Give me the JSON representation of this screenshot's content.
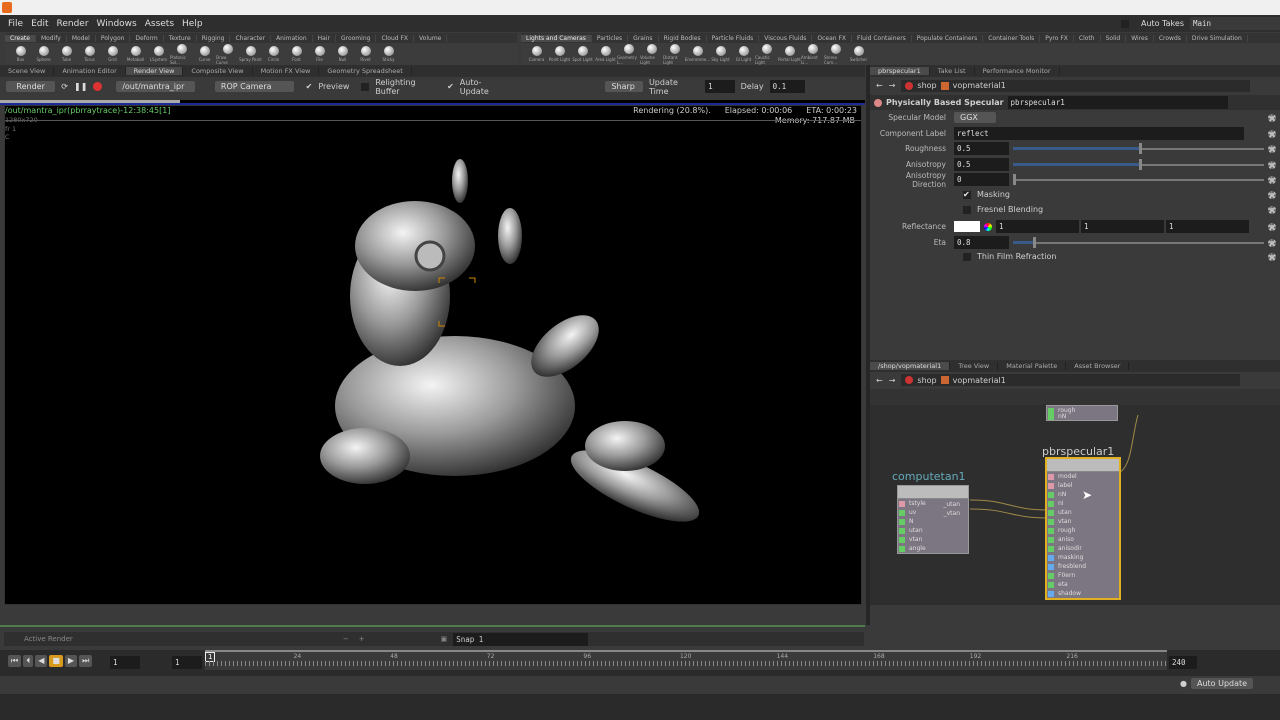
{
  "menu": [
    "File",
    "Edit",
    "Render",
    "Windows",
    "Assets",
    "Help"
  ],
  "auto_takes": "Auto Takes",
  "takes_value": "Main",
  "shelf_left_tabs": [
    "Create",
    "Modify",
    "Model",
    "Polygon",
    "Deform",
    "Texture",
    "Rigging",
    "Character",
    "Animation",
    "Hair",
    "Grooming",
    "Cloud FX",
    "Volume"
  ],
  "shelf_left_tools": [
    "Box",
    "Sphere",
    "Tube",
    "Torus",
    "Grid",
    "Metaball",
    "LSystem",
    "Platonic Sol...",
    "Curve",
    "Draw Curve",
    "Spray Paint",
    "Circle",
    "Font",
    "File",
    "Null",
    "Rivet",
    "Sticky"
  ],
  "shelf_right_tabs": [
    "Lights and Cameras",
    "Particles",
    "Grains",
    "Rigid Bodies",
    "Particle Fluids",
    "Viscous Fluids",
    "Ocean FX",
    "Fluid Containers",
    "Populate Containers",
    "Container Tools",
    "Pyro FX",
    "Cloth",
    "Solid",
    "Wires",
    "Crowds",
    "Drive Simulation"
  ],
  "shelf_right_tools": [
    "Camera",
    "Point Light",
    "Spot Light",
    "Area Light",
    "Geometry L...",
    "Volume Light",
    "Distant Light",
    "Environme...",
    "Sky Light",
    "GI Light",
    "Caustic Light",
    "Portal Light",
    "Ambient Li...",
    "Stereo Cam...",
    "Switcher"
  ],
  "left_pane_tabs": [
    "Scene View",
    "Animation Editor",
    "Render View",
    "Composite View",
    "Motion FX View",
    "Geometry Spreadsheet"
  ],
  "render_toolbar": {
    "render": "Render",
    "rop": "/out/mantra_ipr",
    "camera": "ROP Camera",
    "preview": "Preview",
    "relighting": "Relighting Buffer",
    "auto_update": "Auto-Update",
    "sharp": "Sharp",
    "update_time_label": "Update Time",
    "update_time": "1",
    "delay_label": "Delay",
    "delay": "0.1"
  },
  "render_view": {
    "progress": 0.208,
    "path": "/out/mantra_ipr(pbrraytrace)-12:38:45[1]",
    "resolution": "1280x720",
    "fr": "fr 1",
    "c": "C",
    "status": "Rendering (20.8%).",
    "elapsed": "Elapsed: 0:00:06",
    "eta": "ETA: 0:00:23",
    "memory": "Memory:   717.87 MB"
  },
  "active_render": {
    "label": "Active Render",
    "snap": "Snap 1"
  },
  "timeline": {
    "frame": "1",
    "start": "1",
    "end": "240",
    "current": "1",
    "ticks": [
      "24",
      "48",
      "72",
      "96",
      "120",
      "144",
      "168",
      "192",
      "216"
    ],
    "auto_update": "Auto Update"
  },
  "params_tabs": [
    "pbrspecular1",
    "Take List",
    "Performance Monitor"
  ],
  "path": {
    "shop": "shop",
    "material": "vopmaterial1"
  },
  "params": {
    "type": "Physically Based Specular",
    "name": "pbrspecular1",
    "specular_model_label": "Specular Model",
    "specular_model": "GGX",
    "component_label_label": "Component Label",
    "component_label": "reflect",
    "roughness_label": "Roughness",
    "roughness": "0.5",
    "anisotropy_label": "Anisotropy",
    "anisotropy": "0.5",
    "aniso_dir_label": "Anisotropy Direction",
    "aniso_dir": "0",
    "masking": "Masking",
    "fresnel": "Fresnel Blending",
    "reflectance_label": "Reflectance",
    "reflectance": [
      "1",
      "1",
      "1"
    ],
    "eta_label": "Eta",
    "eta": "0.8",
    "thin_film": "Thin Film Refraction"
  },
  "network_tabs": [
    "/shop/vopmaterial1",
    "Tree View",
    "Material Palette",
    "Asset Browser"
  ],
  "network": {
    "top_ports": [
      "rough",
      "nN"
    ],
    "computetan": {
      "name": "computetan1",
      "inputs": [
        "tstyle",
        "uv",
        "N",
        "utan",
        "vtan",
        "angle"
      ],
      "outputs": [
        "_utan",
        "_vtan"
      ]
    },
    "pbrspecular": {
      "name": "pbrspecular1",
      "inputs": [
        "model",
        "label",
        "nN",
        "nI",
        "utan",
        "vtan",
        "rough",
        "aniso",
        "anisodir",
        "masking",
        "fresblend",
        "F0ern",
        "eta",
        "shadow"
      ]
    }
  }
}
